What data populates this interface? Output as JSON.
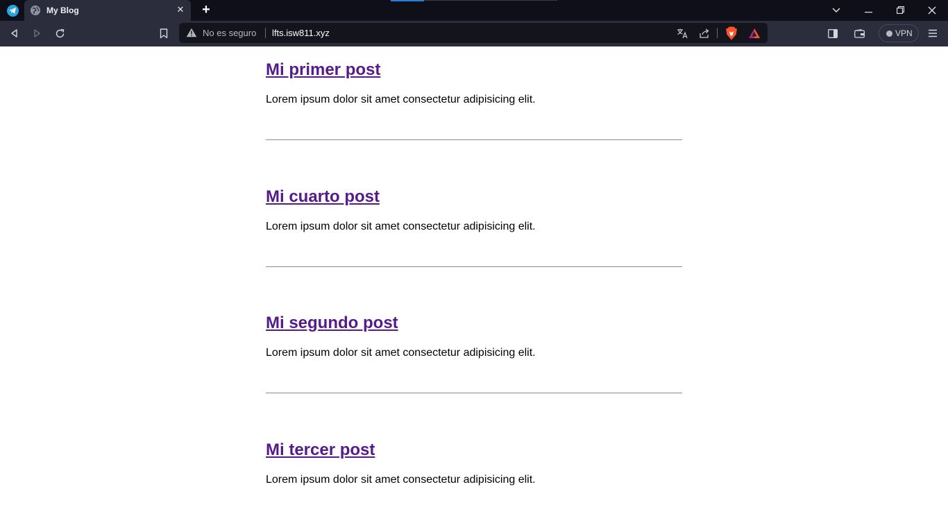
{
  "browser": {
    "tab": {
      "title": "My Blog",
      "close_glyph": "✕"
    },
    "new_tab_glyph": "+",
    "window_controls": {
      "dropdown": "⌄",
      "minimize": "—",
      "restore": "❐",
      "close": "✕"
    },
    "address_bar": {
      "security_label": "No es seguro",
      "url": "lfts.isw811.xyz"
    },
    "vpn_label": "VPN",
    "icons": [
      "back-icon",
      "forward-icon",
      "reload-icon",
      "bookmark-icon",
      "translate-icon",
      "share-icon",
      "brave-shields-icon",
      "brave-rewards-icon",
      "sidebar-icon",
      "wallet-icon",
      "menu-icon"
    ]
  },
  "posts": [
    {
      "title": "Mi primer post",
      "excerpt": "Lorem ipsum dolor sit amet consectetur adipisicing elit."
    },
    {
      "title": "Mi cuarto post",
      "excerpt": "Lorem ipsum dolor sit amet consectetur adipisicing elit."
    },
    {
      "title": "Mi segundo post",
      "excerpt": "Lorem ipsum dolor sit amet consectetur adipisicing elit."
    },
    {
      "title": "Mi tercer post",
      "excerpt": "Lorem ipsum dolor sit amet consectetur adipisicing elit."
    }
  ],
  "colors": {
    "link_visited": "#551a8b",
    "browser_frame": "#0f0f1a",
    "toolbar": "#2b2d3c"
  }
}
